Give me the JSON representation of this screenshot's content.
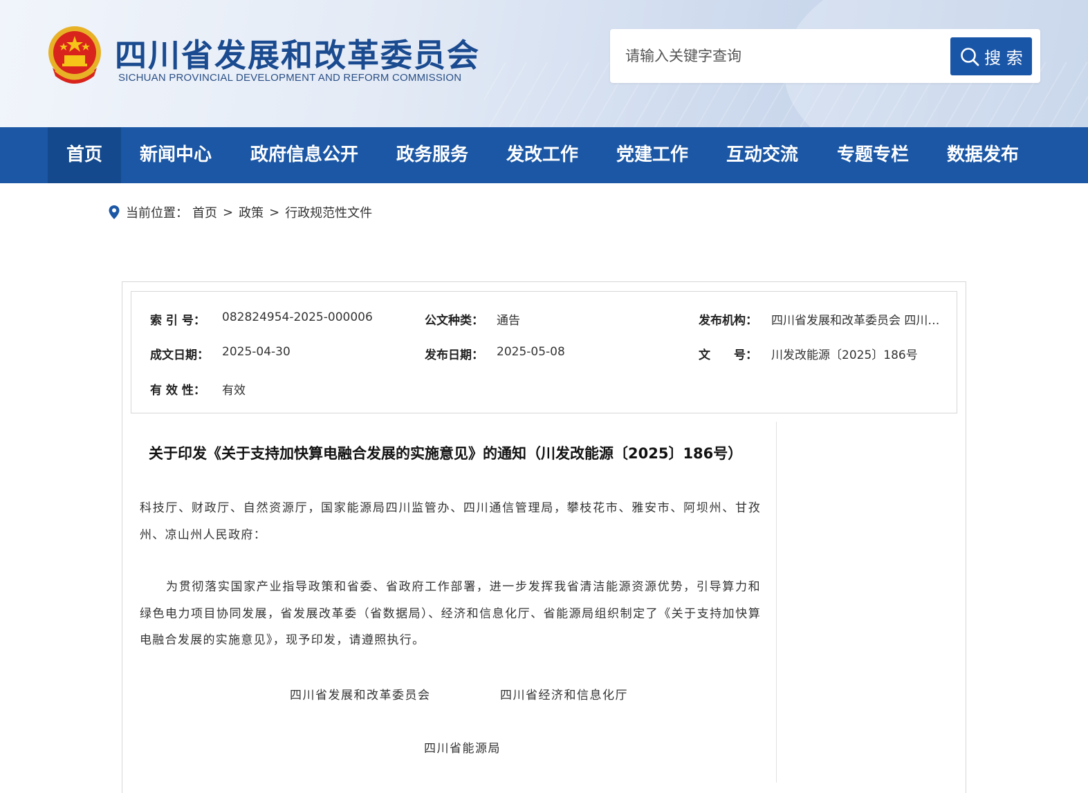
{
  "header": {
    "title": "四川省发展和改革委员会",
    "subtitle": "SICHUAN PROVINCIAL DEVELOPMENT AND REFORM COMMISSION",
    "emblem_icon": "national-emblem-icon",
    "search": {
      "placeholder": "请输入关键字查询",
      "button_label": "搜 索"
    }
  },
  "nav": {
    "items": [
      {
        "label": "首页",
        "active": true
      },
      {
        "label": "新闻中心"
      },
      {
        "label": "政府信息公开"
      },
      {
        "label": "政务服务"
      },
      {
        "label": "发改工作"
      },
      {
        "label": "党建工作"
      },
      {
        "label": "互动交流"
      },
      {
        "label": "专题专栏"
      },
      {
        "label": "数据发布"
      }
    ]
  },
  "breadcrumb": {
    "prefix": "当前位置：",
    "items": [
      "首页",
      "政策",
      "行政规范性文件"
    ],
    "separator": ">"
  },
  "meta": {
    "index_label": "索 引 号：",
    "index_value": "082824954-2025-000006",
    "type_label": "公文种类：",
    "type_value": "通告",
    "publisher_label": "发布机构：",
    "publisher_value": "四川省发展和改革委员会 四川省...",
    "created_label": "成文日期：",
    "created_value": "2025-04-30",
    "published_label": "发布日期：",
    "published_value": "2025-05-08",
    "docno_label": "文　　号：",
    "docno_value": "川发改能源〔2025〕186号",
    "validity_label": "有 效 性：",
    "validity_value": "有效"
  },
  "article": {
    "title": "关于印发《关于支持加快算电融合发展的实施意见》的通知（川发改能源〔2025〕186号）",
    "recipients": "科技厅、财政厅、自然资源厅，国家能源局四川监管办、四川通信管理局，攀枝花市、雅安市、阿坝州、甘孜州、凉山州人民政府：",
    "body": "为贯彻落实国家产业指导政策和省委、省政府工作部署，进一步发挥我省清洁能源资源优势，引导算力和绿色电力项目协同发展，省发展改革委（省数据局）、经济和信息化厅、省能源局组织制定了《关于支持加快算电融合发展的实施意见》，现予印发，请遵照执行。",
    "signers": [
      "四川省发展和改革委员会",
      "四川省经济和信息化厅",
      "四川省能源局"
    ]
  },
  "colors": {
    "primary": "#1b57a5",
    "nav_active": "#144a8d",
    "title_blue": "#1a4a8f"
  }
}
